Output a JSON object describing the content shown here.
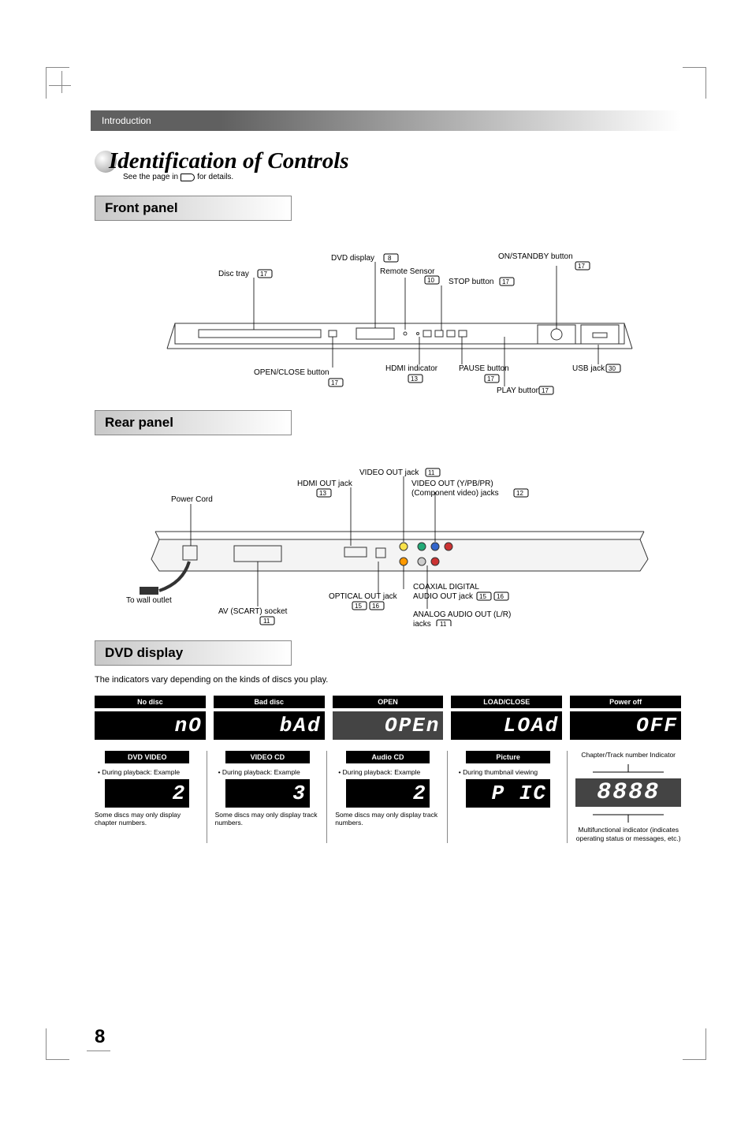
{
  "page_number": "8",
  "header": "Introduction",
  "title": "Identification of Controls",
  "see_page_note_prefix": "See the page in",
  "see_page_note_suffix": "for details.",
  "sections": {
    "front": "Front panel",
    "rear": "Rear panel",
    "display": "DVD display"
  },
  "front_panel": {
    "dvd_display": "DVD display",
    "dvd_display_ref": "8",
    "disc_tray": "Disc tray",
    "disc_tray_ref": "17",
    "remote_sensor": "Remote Sensor",
    "remote_sensor_ref": "10",
    "stop_button": "STOP button",
    "stop_button_ref": "17",
    "on_standby": "ON/STANDBY button",
    "on_standby_ref": "17",
    "open_close": "OPEN/CLOSE button",
    "open_close_ref": "17",
    "hdmi_indicator": "HDMI indicator",
    "hdmi_indicator_ref": "13",
    "pause_button": "PAUSE button",
    "pause_button_ref": "17",
    "play_button": "PLAY button",
    "play_button_ref": "17",
    "usb_jack": "USB jack",
    "usb_jack_ref": "30"
  },
  "rear_panel": {
    "video_out": "VIDEO OUT jack",
    "video_out_ref": "11",
    "hdmi_out": "HDMI OUT jack",
    "hdmi_out_ref": "13",
    "power_cord": "Power Cord",
    "component": "VIDEO OUT (Y/PB/PR)",
    "component_sub": "(Component video) jacks",
    "component_ref": "12",
    "to_wall": "To wall outlet",
    "optical_out": "OPTICAL OUT jack",
    "optical_out_ref1": "15",
    "optical_out_ref2": "16",
    "av_scart": "AV (SCART) socket",
    "av_scart_ref": "11",
    "coaxial": "COAXIAL DIGITAL",
    "coaxial_sub": "AUDIO OUT jack",
    "coaxial_ref1": "15",
    "coaxial_ref2": "16",
    "analog_audio": "ANALOG AUDIO OUT (L/R)",
    "analog_audio_sub": "jacks",
    "analog_audio_ref": "11"
  },
  "display_section": {
    "intro": "The indicators vary depending on the kinds of discs you play.",
    "row1": [
      {
        "label": "No disc",
        "seg": "nO"
      },
      {
        "label": "Bad disc",
        "seg": "bAd"
      },
      {
        "label": "OPEN",
        "seg": "OPEn"
      },
      {
        "label": "LOAD/CLOSE",
        "seg": "LOAd"
      },
      {
        "label": "Power off",
        "seg": "OFF"
      }
    ],
    "row2": [
      {
        "label": "DVD VIDEO",
        "desc": "• During playback: Example",
        "seg": "2",
        "note": "Some discs may only display chapter numbers."
      },
      {
        "label": "VIDEO CD",
        "desc": "• During playback: Example",
        "seg": "3",
        "note": "Some discs may only display track numbers."
      },
      {
        "label": "Audio CD",
        "desc": "• During playback: Example",
        "seg": "2",
        "note": "Some discs may only display track numbers."
      },
      {
        "label": "Picture",
        "desc": "• During thumbnail viewing",
        "seg": "P IC",
        "note": ""
      }
    ],
    "indicator": {
      "top_label": "Chapter/Track number Indicator",
      "seg": "8888",
      "caption": "Multifunctional indicator (indicates operating status or messages, etc.)"
    }
  }
}
